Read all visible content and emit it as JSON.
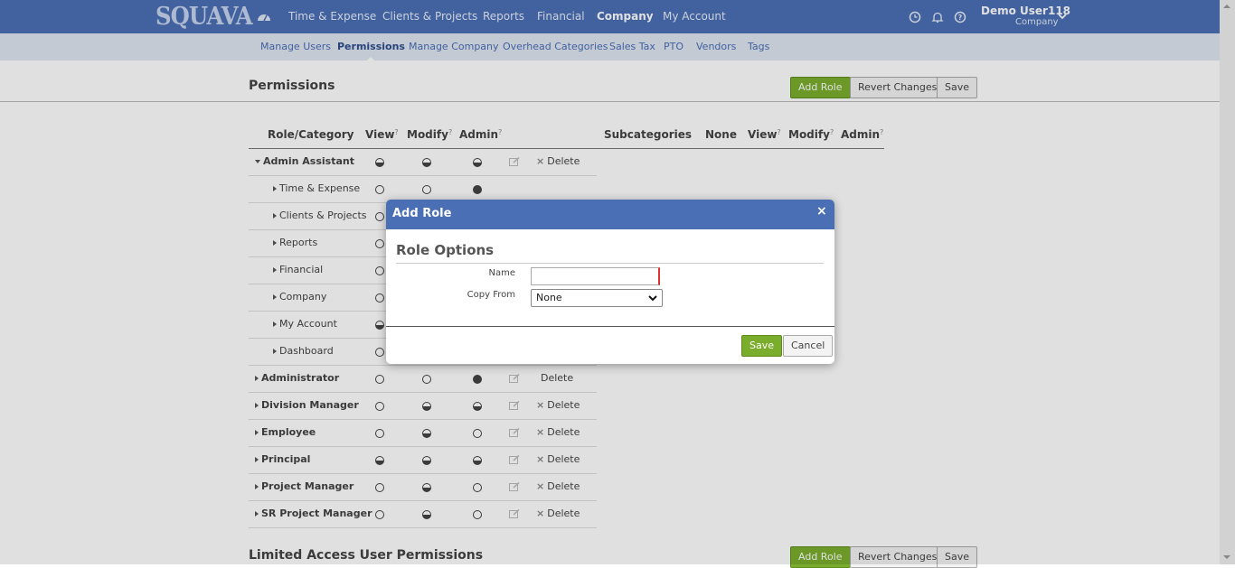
{
  "app": {
    "logo": "SQUAVA"
  },
  "topnav": {
    "items": [
      {
        "label": "Time & Expense"
      },
      {
        "label": "Clients & Projects"
      },
      {
        "label": "Reports"
      },
      {
        "label": "Financial"
      },
      {
        "label": "Company",
        "active": true
      },
      {
        "label": "My Account"
      }
    ],
    "icons": [
      "dashboard-icon",
      "clock-icon",
      "bell-icon",
      "help-icon"
    ],
    "user": {
      "name": "Demo User118",
      "subtitle": "Company"
    }
  },
  "subnav": {
    "items": [
      {
        "label": "Manage Users"
      },
      {
        "label": "Permissions",
        "active": true
      },
      {
        "label": "Manage Company"
      },
      {
        "label": "Overhead Categories"
      },
      {
        "label": "Sales Tax"
      },
      {
        "label": "PTO"
      },
      {
        "label": "Vendors"
      },
      {
        "label": "Tags"
      }
    ]
  },
  "permissions": {
    "title": "Permissions",
    "add_role": "Add Role",
    "revert": "Revert Changes",
    "save": "Save",
    "headers": {
      "role": "Role/Category",
      "view": "View",
      "modify": "Modify",
      "admin": "Admin",
      "subcategories": "Subcategories",
      "none": "None",
      "sub_view": "View",
      "sub_modify": "Modify",
      "sub_admin": "Admin",
      "help_mark": "?"
    },
    "delete_label": "Delete",
    "rows": [
      {
        "label": "Admin Assistant",
        "level": 0,
        "expanded": true,
        "view": "half",
        "modify": "half",
        "admin": "half",
        "delete": true
      },
      {
        "label": "Time & Expense",
        "level": 1,
        "view": "empty",
        "modify": "empty",
        "admin": "full"
      },
      {
        "label": "Clients & Projects",
        "level": 1,
        "view": "empty"
      },
      {
        "label": "Reports",
        "level": 1,
        "view": "empty"
      },
      {
        "label": "Financial",
        "level": 1,
        "view": "empty"
      },
      {
        "label": "Company",
        "level": 1,
        "view": "empty"
      },
      {
        "label": "My Account",
        "level": 1,
        "view": "half"
      },
      {
        "label": "Dashboard",
        "level": 1,
        "view": "empty"
      },
      {
        "label": "Administrator",
        "level": 0,
        "view": "empty",
        "modify": "empty",
        "admin": "full",
        "delete": false
      },
      {
        "label": "Division Manager",
        "level": 0,
        "view": "empty",
        "modify": "half",
        "admin": "half",
        "delete": true
      },
      {
        "label": "Employee",
        "level": 0,
        "view": "empty",
        "modify": "half",
        "admin": "empty",
        "delete": true
      },
      {
        "label": "Principal",
        "level": 0,
        "view": "half",
        "modify": "half",
        "admin": "half",
        "delete": true
      },
      {
        "label": "Project Manager",
        "level": 0,
        "view": "empty",
        "modify": "half",
        "admin": "empty",
        "delete": true
      },
      {
        "label": "SR Project Manager",
        "level": 0,
        "view": "empty",
        "modify": "half",
        "admin": "empty",
        "delete": true
      }
    ]
  },
  "limited": {
    "title": "Limited Access User Permissions",
    "add_role": "Add Role",
    "revert": "Revert Changes",
    "save": "Save"
  },
  "modal": {
    "title": "Add Role",
    "close": "×",
    "section": "Role Options",
    "name_label": "Name",
    "name_value": "",
    "copy_label": "Copy From",
    "copy_value": "None",
    "save": "Save",
    "cancel": "Cancel"
  },
  "colors": {
    "brand": "#4a6fb5",
    "subnav_bg": "#dfe6f2",
    "accent_green": "#7aad2c"
  }
}
